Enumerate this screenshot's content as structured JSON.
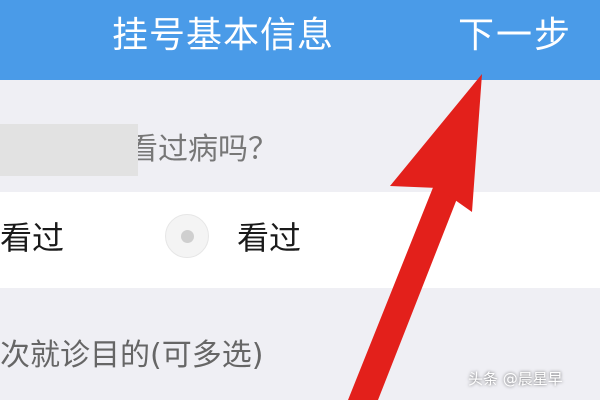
{
  "header": {
    "title": "挂号基本信息",
    "next_label": "下一步"
  },
  "question": {
    "text_partial": "看过病吗？"
  },
  "options": {
    "left_partial": "看过",
    "radio_label": "看过"
  },
  "purpose": {
    "label_partial": "次就诊目的(可多选)"
  },
  "watermark": {
    "text": "头条 @晨星早"
  },
  "colors": {
    "header_bg": "#4a9be8",
    "arrow": "#e3201b"
  }
}
